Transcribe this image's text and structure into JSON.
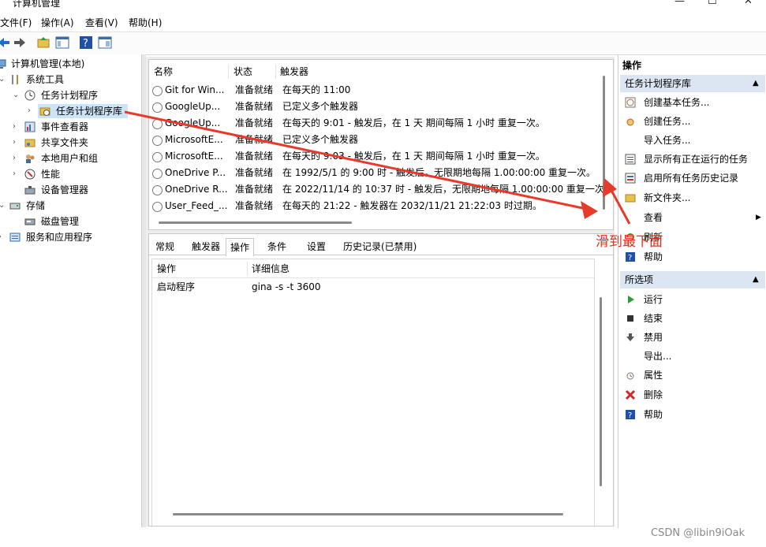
{
  "window": {
    "title": "计算机管理"
  },
  "menu": [
    "文件(F)",
    "操作(A)",
    "查看(V)",
    "帮助(H)"
  ],
  "tree": [
    {
      "label": "计算机管理(本地)",
      "depth": 0,
      "expander": ""
    },
    {
      "label": "系统工具",
      "depth": 1,
      "expander": "v"
    },
    {
      "label": "任务计划程序",
      "depth": 2,
      "expander": "v"
    },
    {
      "label": "任务计划程序库",
      "depth": 3,
      "expander": ">",
      "selected": true
    },
    {
      "label": "事件查看器",
      "depth": 2,
      "expander": ">"
    },
    {
      "label": "共享文件夹",
      "depth": 2,
      "expander": ">"
    },
    {
      "label": "本地用户和组",
      "depth": 2,
      "expander": ">"
    },
    {
      "label": "性能",
      "depth": 2,
      "expander": ">"
    },
    {
      "label": "设备管理器",
      "depth": 2,
      "expander": ""
    },
    {
      "label": "存储",
      "depth": 1,
      "expander": "v"
    },
    {
      "label": "磁盘管理",
      "depth": 2,
      "expander": ""
    },
    {
      "label": "服务和应用程序",
      "depth": 1,
      "expander": ">"
    }
  ],
  "task_list": {
    "columns": [
      "名称",
      "状态",
      "触发器"
    ],
    "rows": [
      {
        "name": "Git for Win...",
        "status": "准备就绪",
        "trigger": "在每天的 11:00"
      },
      {
        "name": "GoogleUp...",
        "status": "准备就绪",
        "trigger": "已定义多个触发器"
      },
      {
        "name": "GoogleUp...",
        "status": "准备就绪",
        "trigger": "在每天的 9:01 - 触发后，在 1 天 期间每隔 1 小时 重复一次。"
      },
      {
        "name": "MicrosoftE...",
        "status": "准备就绪",
        "trigger": "已定义多个触发器"
      },
      {
        "name": "MicrosoftE...",
        "status": "准备就绪",
        "trigger": "在每天的 9:03 - 触发后，在 1 天 期间每隔 1 小时 重复一次。"
      },
      {
        "name": "OneDrive P...",
        "status": "准备就绪",
        "trigger": "在 1992/5/1 的 9:00 时 - 触发后，无限期地每隔 1.00:00:00 重复一次。"
      },
      {
        "name": "OneDrive R...",
        "status": "准备就绪",
        "trigger": "在 2022/11/14 的 10:37 时 - 触发后，无限期地每隔 1.00:00:00 重复一次。"
      },
      {
        "name": "User_Feed_...",
        "status": "准备就绪",
        "trigger": "在每天的 21:22 - 触发器在 2032/11/21 21:22:03 时过期。"
      }
    ]
  },
  "detail_tabs": [
    "常规",
    "触发器",
    "操作",
    "条件",
    "设置",
    "历史记录(已禁用)"
  ],
  "detail_active_tab": "操作",
  "action_table": {
    "columns": [
      "操作",
      "详细信息"
    ],
    "rows": [
      {
        "action": "启动程序",
        "detail": "gina -s -t 3600"
      }
    ]
  },
  "actions_pane": {
    "title": "操作",
    "section1": {
      "title": "任务计划程序库",
      "items": [
        {
          "label": "创建基本任务...",
          "icon": "clock-icon"
        },
        {
          "label": "创建任务...",
          "icon": "clock-icon"
        },
        {
          "label": "导入任务...",
          "icon": ""
        },
        {
          "label": "显示所有正在运行的任务",
          "icon": "list-icon"
        },
        {
          "label": "启用所有任务历史记录",
          "icon": "history-icon"
        },
        {
          "label": "新文件夹...",
          "icon": "folder-icon"
        },
        {
          "label": "查看",
          "icon": "",
          "submenu": true
        },
        {
          "label": "刷新",
          "icon": "refresh-icon"
        },
        {
          "label": "帮助",
          "icon": "help-icon"
        }
      ]
    },
    "section2": {
      "title": "所选项",
      "items": [
        {
          "label": "运行",
          "icon": "run-icon"
        },
        {
          "label": "结束",
          "icon": "stop-icon"
        },
        {
          "label": "禁用",
          "icon": "disable-icon"
        },
        {
          "label": "导出...",
          "icon": ""
        },
        {
          "label": "属性",
          "icon": "properties-icon"
        },
        {
          "label": "删除",
          "icon": "delete-icon"
        },
        {
          "label": "帮助",
          "icon": "help-icon"
        }
      ]
    }
  },
  "annotation": {
    "text": "滑到最下面",
    "color": "#e0301e"
  },
  "watermark": "CSDN @libin9iOak"
}
